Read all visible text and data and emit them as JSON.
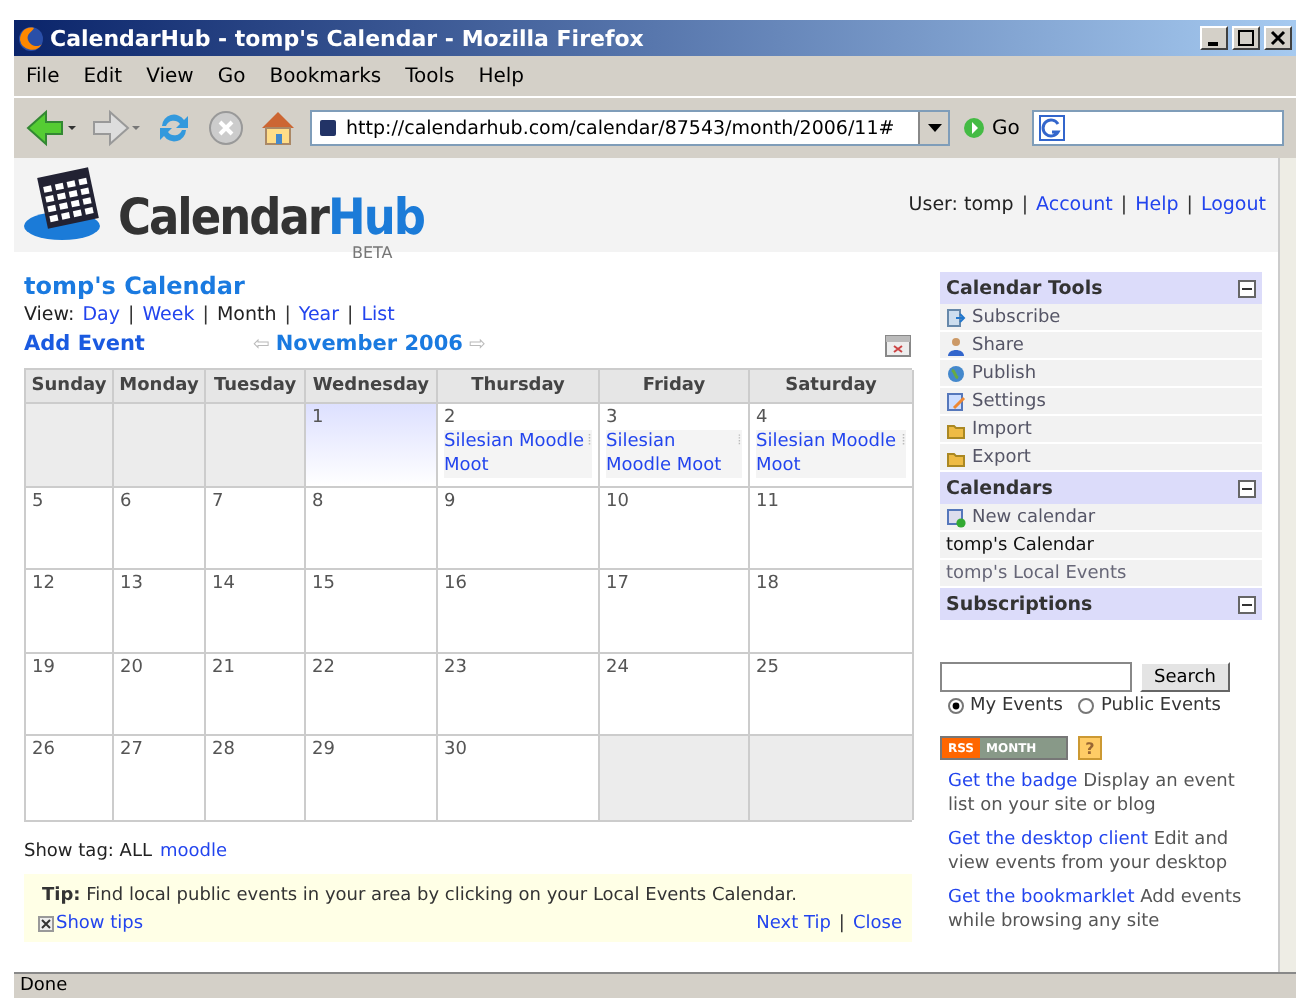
{
  "window": {
    "title": "CalendarHub - tomp's Calendar - Mozilla Firefox"
  },
  "menu": [
    "File",
    "Edit",
    "View",
    "Go",
    "Bookmarks",
    "Tools",
    "Help"
  ],
  "toolbar": {
    "url": "http://calendarhub.com/calendar/87543/month/2006/11#",
    "go_label": "Go"
  },
  "header": {
    "logo": [
      "Calendar",
      "Hub"
    ],
    "beta": "BETA",
    "user_label": "User: tomp",
    "links": [
      "Account",
      "Help",
      "Logout"
    ],
    "separator": "|"
  },
  "calendar": {
    "title": "tomp's Calendar",
    "view_label": "View:",
    "views": [
      {
        "label": "Day",
        "selected": false
      },
      {
        "label": "Week",
        "selected": false
      },
      {
        "label": "Month",
        "selected": true
      },
      {
        "label": "Year",
        "selected": false
      },
      {
        "label": "List",
        "selected": false
      }
    ],
    "add_event": "Add Event",
    "month": "November 2006",
    "prev_arrow": "⇦",
    "next_arrow": "⇨",
    "separator": "|",
    "weekdays": [
      "Sunday",
      "Monday",
      "Tuesday",
      "Wednesday",
      "Thursday",
      "Friday",
      "Saturday"
    ],
    "weeks": [
      [
        {
          "in_month": false
        },
        {
          "in_month": false
        },
        {
          "in_month": false
        },
        {
          "in_month": true,
          "day": "1",
          "today": true
        },
        {
          "in_month": true,
          "day": "2",
          "today": false,
          "events": [
            "Silesian Moodle Moot"
          ]
        },
        {
          "in_month": true,
          "day": "3",
          "today": false,
          "events": [
            "Silesian Moodle Moot"
          ]
        },
        {
          "in_month": true,
          "day": "4",
          "today": false,
          "events": [
            "Silesian Moodle Moot"
          ]
        }
      ],
      [
        {
          "in_month": true,
          "day": "5",
          "today": false
        },
        {
          "in_month": true,
          "day": "6",
          "today": false
        },
        {
          "in_month": true,
          "day": "7",
          "today": false
        },
        {
          "in_month": true,
          "day": "8",
          "today": false
        },
        {
          "in_month": true,
          "day": "9",
          "today": false
        },
        {
          "in_month": true,
          "day": "10",
          "today": false
        },
        {
          "in_month": true,
          "day": "11",
          "today": false
        }
      ],
      [
        {
          "in_month": true,
          "day": "12",
          "today": false
        },
        {
          "in_month": true,
          "day": "13",
          "today": false
        },
        {
          "in_month": true,
          "day": "14",
          "today": false
        },
        {
          "in_month": true,
          "day": "15",
          "today": false
        },
        {
          "in_month": true,
          "day": "16",
          "today": false
        },
        {
          "in_month": true,
          "day": "17",
          "today": false
        },
        {
          "in_month": true,
          "day": "18",
          "today": false
        }
      ],
      [
        {
          "in_month": true,
          "day": "19",
          "today": false
        },
        {
          "in_month": true,
          "day": "20",
          "today": false
        },
        {
          "in_month": true,
          "day": "21",
          "today": false
        },
        {
          "in_month": true,
          "day": "22",
          "today": false
        },
        {
          "in_month": true,
          "day": "23",
          "today": false
        },
        {
          "in_month": true,
          "day": "24",
          "today": false
        },
        {
          "in_month": true,
          "day": "25",
          "today": false
        }
      ],
      [
        {
          "in_month": true,
          "day": "26",
          "today": false
        },
        {
          "in_month": true,
          "day": "27",
          "today": false
        },
        {
          "in_month": true,
          "day": "28",
          "today": false
        },
        {
          "in_month": true,
          "day": "29",
          "today": false
        },
        {
          "in_month": true,
          "day": "30",
          "today": false
        },
        {
          "in_month": false
        },
        {
          "in_month": false
        }
      ]
    ],
    "tag_label": "Show tag: ALL",
    "tags": [
      "moodle"
    ]
  },
  "tip": {
    "label": "Tip:",
    "text": "Find local public events in your area by clicking on your Local Events Calendar.",
    "show_tips": "Show tips",
    "next": "Next Tip",
    "close": "Close",
    "separator": "|"
  },
  "sidebar": {
    "sections": [
      {
        "title": "Calendar Tools",
        "items": [
          {
            "label": "Subscribe",
            "kind": "subscribe"
          },
          {
            "label": "Share",
            "kind": "share"
          },
          {
            "label": "Publish",
            "kind": "publish"
          },
          {
            "label": "Settings",
            "kind": "settings"
          },
          {
            "label": "Import",
            "kind": "folder"
          },
          {
            "label": "Export",
            "kind": "folder"
          }
        ]
      },
      {
        "title": "Calendars",
        "items": [
          {
            "label": "New calendar",
            "kind": "new"
          },
          {
            "label": "tomp's Calendar",
            "kind": "current"
          },
          {
            "label": "tomp's Local Events",
            "kind": "plain"
          }
        ]
      },
      {
        "title": "Subscriptions"
      }
    ],
    "search_button": "Search",
    "scopes": [
      {
        "label": "My Events",
        "selected": true
      },
      {
        "label": "Public Events",
        "selected": false
      }
    ],
    "rss": [
      "RSS",
      "MONTH"
    ],
    "help": "?",
    "promos": [
      {
        "link": "Get the badge",
        "text": "Display an event list on your site or blog"
      },
      {
        "link": "Get the desktop client",
        "text": "Edit and view events from your desktop"
      },
      {
        "link": "Get the bookmarklet",
        "text": "Add events while browsing any site"
      }
    ]
  },
  "status_bar": "Done"
}
